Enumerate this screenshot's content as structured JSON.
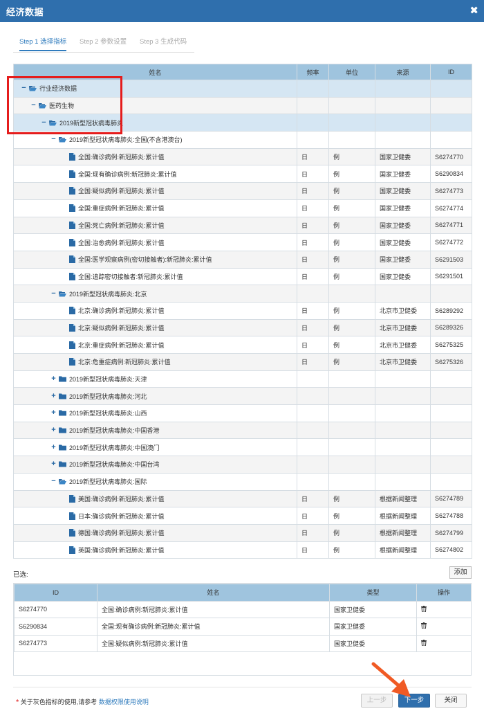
{
  "window": {
    "title": "经济数据",
    "close_glyph": "✖"
  },
  "tabs": [
    {
      "label": "Step 1 选择指标",
      "active": true
    },
    {
      "label": "Step 2 参数设置",
      "active": false
    },
    {
      "label": "Step 3 生成代码",
      "active": false
    }
  ],
  "grid": {
    "headers": [
      "姓名",
      "频率",
      "单位",
      "来源",
      "ID"
    ],
    "rows": [
      {
        "level": 0,
        "toggle": "−",
        "icon": "folder-open-icon",
        "name": "行业经济数据",
        "freq": "",
        "unit": "",
        "source": "",
        "id": "",
        "style": "hl"
      },
      {
        "level": 1,
        "toggle": "−",
        "icon": "folder-open-icon",
        "name": "医药生物",
        "freq": "",
        "unit": "",
        "source": "",
        "id": "",
        "style": "alt"
      },
      {
        "level": 2,
        "toggle": "−",
        "icon": "folder-open-icon",
        "name": "2019新型冠状病毒肺炎",
        "freq": "",
        "unit": "",
        "source": "",
        "id": "",
        "style": "hl"
      },
      {
        "level": 3,
        "toggle": "−",
        "icon": "folder-open-icon",
        "name": "2019新型冠状病毒肺炎:全国(不含港澳台)",
        "freq": "",
        "unit": "",
        "source": "",
        "id": "",
        "style": ""
      },
      {
        "level": 4,
        "toggle": "",
        "icon": "file-icon",
        "name": "全国:确诊病例:新冠肺炎:累计值",
        "freq": "日",
        "unit": "例",
        "source": "国家卫健委",
        "id": "S6274770",
        "style": "alt"
      },
      {
        "level": 4,
        "toggle": "",
        "icon": "file-icon",
        "name": "全国:现有确诊病例:新冠肺炎:累计值",
        "freq": "日",
        "unit": "例",
        "source": "国家卫健委",
        "id": "S6290834",
        "style": ""
      },
      {
        "level": 4,
        "toggle": "",
        "icon": "file-icon",
        "name": "全国:疑似病例:新冠肺炎:累计值",
        "freq": "日",
        "unit": "例",
        "source": "国家卫健委",
        "id": "S6274773",
        "style": "alt"
      },
      {
        "level": 4,
        "toggle": "",
        "icon": "file-icon",
        "name": "全国:重症病例:新冠肺炎:累计值",
        "freq": "日",
        "unit": "例",
        "source": "国家卫健委",
        "id": "S6274774",
        "style": ""
      },
      {
        "level": 4,
        "toggle": "",
        "icon": "file-icon",
        "name": "全国:死亡病例:新冠肺炎:累计值",
        "freq": "日",
        "unit": "例",
        "source": "国家卫健委",
        "id": "S6274771",
        "style": "alt"
      },
      {
        "level": 4,
        "toggle": "",
        "icon": "file-icon",
        "name": "全国:治愈病例:新冠肺炎:累计值",
        "freq": "日",
        "unit": "例",
        "source": "国家卫健委",
        "id": "S6274772",
        "style": ""
      },
      {
        "level": 4,
        "toggle": "",
        "icon": "file-icon",
        "name": "全国:医学观察病例(密切接触者):新冠肺炎:累计值",
        "freq": "日",
        "unit": "例",
        "source": "国家卫健委",
        "id": "S6291503",
        "style": "alt"
      },
      {
        "level": 4,
        "toggle": "",
        "icon": "file-icon",
        "name": "全国:追踪密切接触者:新冠肺炎:累计值",
        "freq": "日",
        "unit": "例",
        "source": "国家卫健委",
        "id": "S6291501",
        "style": ""
      },
      {
        "level": 3,
        "toggle": "−",
        "icon": "folder-open-icon",
        "name": "2019新型冠状病毒肺炎:北京",
        "freq": "",
        "unit": "",
        "source": "",
        "id": "",
        "style": "alt"
      },
      {
        "level": 4,
        "toggle": "",
        "icon": "file-icon",
        "name": "北京:确诊病例:新冠肺炎:累计值",
        "freq": "日",
        "unit": "例",
        "source": "北京市卫健委",
        "id": "S6289292",
        "style": ""
      },
      {
        "level": 4,
        "toggle": "",
        "icon": "file-icon",
        "name": "北京:疑似病例:新冠肺炎:累计值",
        "freq": "日",
        "unit": "例",
        "source": "北京市卫健委",
        "id": "S6289326",
        "style": "alt"
      },
      {
        "level": 4,
        "toggle": "",
        "icon": "file-icon",
        "name": "北京:重症病例:新冠肺炎:累计值",
        "freq": "日",
        "unit": "例",
        "source": "北京市卫健委",
        "id": "S6275325",
        "style": ""
      },
      {
        "level": 4,
        "toggle": "",
        "icon": "file-icon",
        "name": "北京:危重症病例:新冠肺炎:累计值",
        "freq": "日",
        "unit": "例",
        "source": "北京市卫健委",
        "id": "S6275326",
        "style": "alt"
      },
      {
        "level": 3,
        "toggle": "+",
        "icon": "folder-closed-icon",
        "name": "2019新型冠状病毒肺炎:天津",
        "freq": "",
        "unit": "",
        "source": "",
        "id": "",
        "style": ""
      },
      {
        "level": 3,
        "toggle": "+",
        "icon": "folder-closed-icon",
        "name": "2019新型冠状病毒肺炎:河北",
        "freq": "",
        "unit": "",
        "source": "",
        "id": "",
        "style": "alt"
      },
      {
        "level": 3,
        "toggle": "+",
        "icon": "folder-closed-icon",
        "name": "2019新型冠状病毒肺炎:山西",
        "freq": "",
        "unit": "",
        "source": "",
        "id": "",
        "style": ""
      },
      {
        "level": 3,
        "toggle": "+",
        "icon": "folder-closed-icon",
        "name": "2019新型冠状病毒肺炎:中国香港",
        "freq": "",
        "unit": "",
        "source": "",
        "id": "",
        "style": "alt"
      },
      {
        "level": 3,
        "toggle": "+",
        "icon": "folder-closed-icon",
        "name": "2019新型冠状病毒肺炎:中国澳门",
        "freq": "",
        "unit": "",
        "source": "",
        "id": "",
        "style": ""
      },
      {
        "level": 3,
        "toggle": "+",
        "icon": "folder-closed-icon",
        "name": "2019新型冠状病毒肺炎:中国台湾",
        "freq": "",
        "unit": "",
        "source": "",
        "id": "",
        "style": "alt"
      },
      {
        "level": 3,
        "toggle": "−",
        "icon": "folder-open-icon",
        "name": "2019新型冠状病毒肺炎:国际",
        "freq": "",
        "unit": "",
        "source": "",
        "id": "",
        "style": ""
      },
      {
        "level": 4,
        "toggle": "",
        "icon": "file-icon",
        "name": "美国:确诊病例:新冠肺炎:累计值",
        "freq": "日",
        "unit": "例",
        "source": "根据新闻整理",
        "id": "S6274789",
        "style": "alt"
      },
      {
        "level": 4,
        "toggle": "",
        "icon": "file-icon",
        "name": "日本:确诊病例:新冠肺炎:累计值",
        "freq": "日",
        "unit": "例",
        "source": "根据新闻整理",
        "id": "S6274788",
        "style": ""
      },
      {
        "level": 4,
        "toggle": "",
        "icon": "file-icon",
        "name": "德国:确诊病例:新冠肺炎:累计值",
        "freq": "日",
        "unit": "例",
        "source": "根据新闻整理",
        "id": "S6274799",
        "style": "alt"
      },
      {
        "level": 4,
        "toggle": "",
        "icon": "file-icon",
        "name": "英国:确诊病例:新冠肺炎:累计值",
        "freq": "日",
        "unit": "例",
        "source": "根据新闻整理",
        "id": "S6274802",
        "style": ""
      }
    ]
  },
  "selected": {
    "label": "已选:",
    "add_button": "添加",
    "headers": [
      "ID",
      "姓名",
      "类型",
      "操作"
    ],
    "rows": [
      {
        "id": "S6274770",
        "name": "全国:确诊病例:新冠肺炎:累计值",
        "type": "国家卫健委",
        "action_icon": "trash-icon"
      },
      {
        "id": "S6290834",
        "name": "全国:现有确诊病例:新冠肺炎:累计值",
        "type": "国家卫健委",
        "action_icon": "trash-icon"
      },
      {
        "id": "S6274773",
        "name": "全国:疑似病例:新冠肺炎:累计值",
        "type": "国家卫健委",
        "action_icon": "trash-icon"
      }
    ]
  },
  "footer": {
    "note_star": "*",
    "note_text": "关于灰色指标的使用,请参考",
    "note_link": "数据权限使用说明",
    "prev_button": "上一步",
    "next_button": "下一步",
    "close_button": "关闭"
  },
  "colors": {
    "titlebar": "#2f6fad",
    "header": "#9fc4de",
    "highlight_row": "#d5e6f3",
    "annotation_box": "#e51c1c",
    "annotation_arrow": "#f05a24"
  }
}
